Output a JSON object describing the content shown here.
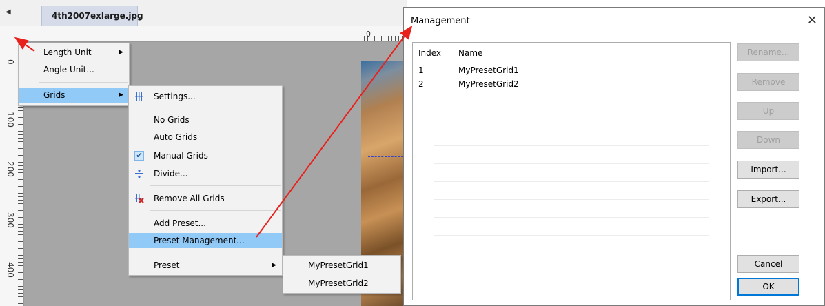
{
  "editor": {
    "tab_title": "4th2007exlarge.jpg",
    "top_ruler_start": "0",
    "left_ruler_labels": [
      "0",
      "100",
      "200",
      "300",
      "400"
    ]
  },
  "context_menu": {
    "items": [
      {
        "label": "Length Unit",
        "submenu": true
      },
      {
        "label": "Angle Unit..."
      },
      {
        "label": "Grids",
        "submenu": true,
        "highlighted": true
      }
    ]
  },
  "grids_menu": {
    "items": [
      {
        "label": "Settings...",
        "icon": "grid-icon"
      },
      {
        "label": "No Grids"
      },
      {
        "label": "Auto Grids"
      },
      {
        "label": "Manual Grids",
        "checked": true
      },
      {
        "label": "Divide...",
        "icon": "divide-icon"
      },
      {
        "label": "Remove All Grids",
        "icon": "remove-grid-icon"
      },
      {
        "label": "Add Preset..."
      },
      {
        "label": "Preset Management...",
        "highlighted": true
      },
      {
        "label": "Preset",
        "submenu": true
      }
    ]
  },
  "preset_menu": {
    "items": [
      "MyPresetGrid1",
      "MyPresetGrid2"
    ]
  },
  "dialog": {
    "title": "Management",
    "close_label": "✕",
    "columns": [
      "Index",
      "Name"
    ],
    "rows": [
      {
        "index": "1",
        "name": "MyPresetGrid1"
      },
      {
        "index": "2",
        "name": "MyPresetGrid2"
      }
    ],
    "buttons": {
      "rename": "Rename...",
      "remove": "Remove",
      "up": "Up",
      "down": "Down",
      "import": "Import...",
      "export": "Export...",
      "cancel": "Cancel",
      "ok": "OK"
    }
  },
  "colors": {
    "highlight": "#91c9f7",
    "annotation_arrow": "#e8211c",
    "accent": "#0078d7"
  }
}
